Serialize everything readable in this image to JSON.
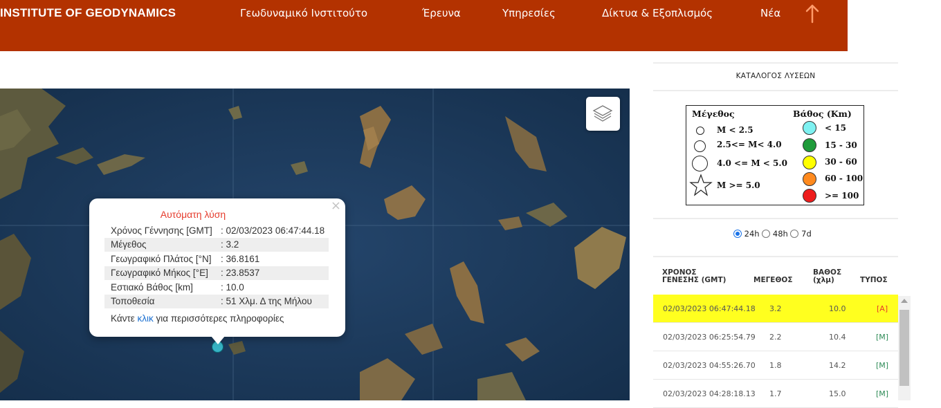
{
  "header": {
    "brand": "INSTITUTE OF GEODYNAMICS",
    "nav": [
      "Γεωδυναμικό Ινστιτούτο",
      "Έρευνα",
      "Υπηρεσίες",
      "Δίκτυα & Εξοπλισμός",
      "Νέα"
    ],
    "background_color": "#b33200"
  },
  "map": {
    "layers_icon": "layers-icon",
    "popup": {
      "close": "×",
      "title": "Αυτόματη λύση",
      "rows": [
        {
          "label": "Χρόνος Γέννησης [GMT]",
          "value": ": 02/03/2023 06:47:44.18"
        },
        {
          "label": "Μέγεθος",
          "value": ": 3.2"
        },
        {
          "label": "Γεωγραφικό Πλάτος [°N]",
          "value": ": 36.8161"
        },
        {
          "label": "Γεωγραφικό Μήκος [°E]",
          "value": ": 23.8537"
        },
        {
          "label": "Εστιακό Βάθος [km]",
          "value": ": 10.0"
        },
        {
          "label": "Τοποθεσία",
          "value": ": 51 Χλμ. Δ της Μήλου"
        }
      ],
      "more_prefix": "Κάντε",
      "more_link": "κλικ",
      "more_suffix": "για περισσότερες πληροφορίες"
    }
  },
  "panel": {
    "title": "ΚΑΤΑΛΟΓΟΣ ΛΥΣΕΩΝ",
    "legend": {
      "magnitude_header": "Μέγεθος",
      "depth_header": "Βάθος (Km)",
      "magnitudes": [
        "M < 2.5",
        "2.5<= M< 4.0",
        "4.0 <= M < 5.0",
        "M >= 5.0"
      ],
      "depths": [
        {
          "label": "< 15",
          "color": "#7ef1f1"
        },
        {
          "label": "15 - 30",
          "color": "#1f9b3a"
        },
        {
          "label": "30 - 60",
          "color": "#ffff00"
        },
        {
          "label": "60 - 100",
          "color": "#ff8a1e"
        },
        {
          "label": ">= 100",
          "color": "#ee1c1c"
        }
      ]
    },
    "ranges": [
      "24h",
      "48h",
      "7d"
    ],
    "selected_range": "24h",
    "columns": {
      "time": [
        "ΧΡΟΝΟΣ",
        "ΓΕΝΕΣΗΣ (GMT)"
      ],
      "magnitude": "ΜΕΓΕΘΟΣ",
      "depth": [
        "ΒΑΘΟΣ",
        "(χλμ)"
      ],
      "type": "ΤΥΠΟΣ"
    },
    "events": [
      {
        "time": "02/03/2023 06:47:44.18",
        "magnitude": "3.2",
        "depth": "10.0",
        "type": "[A]"
      },
      {
        "time": "02/03/2023 06:25:54.79",
        "magnitude": "2.2",
        "depth": "10.4",
        "type": "[M]"
      },
      {
        "time": "02/03/2023 04:55:26.70",
        "magnitude": "1.8",
        "depth": "14.2",
        "type": "[M]"
      },
      {
        "time": "02/03/2023 04:28:18.13",
        "magnitude": "1.7",
        "depth": "15.0",
        "type": "[M]"
      }
    ],
    "highlight_color": "#ffff1f"
  }
}
